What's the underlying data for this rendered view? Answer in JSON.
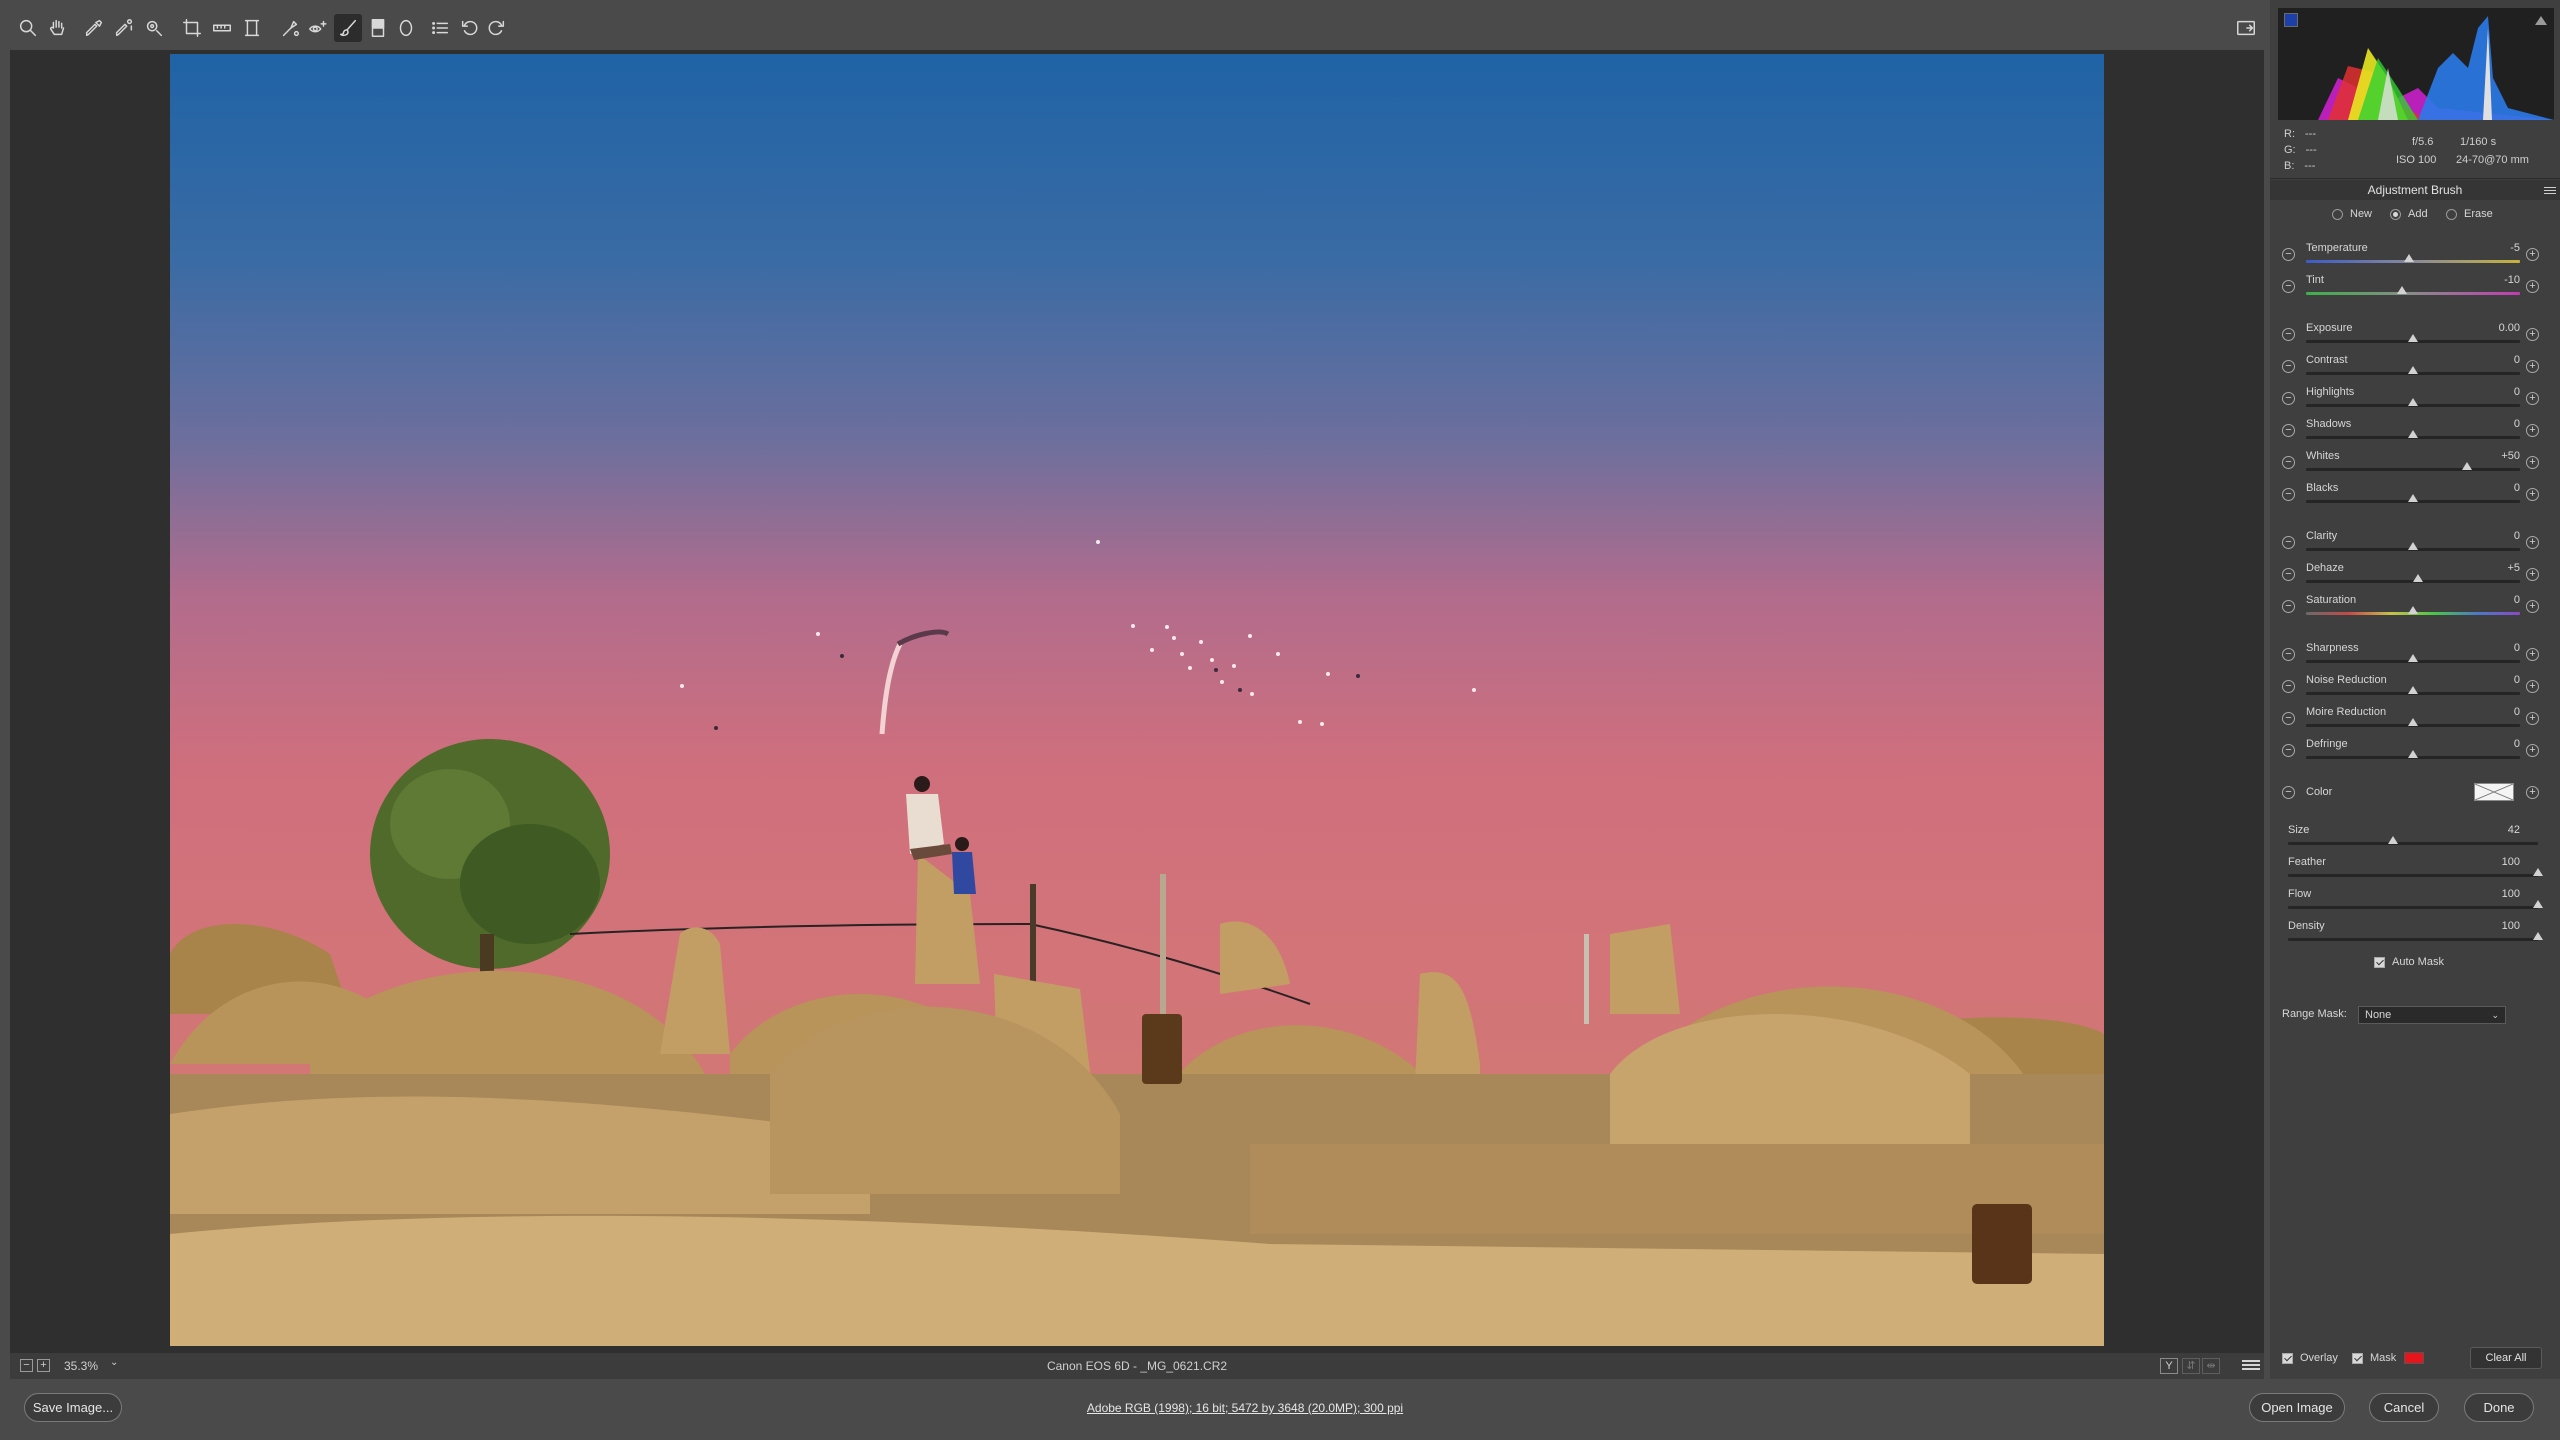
{
  "toolbar": {
    "tools": [
      {
        "name": "zoom-tool",
        "icon": "magnifier-icon"
      },
      {
        "name": "hand-tool",
        "icon": "hand-icon"
      },
      {
        "name": "white-balance-tool",
        "icon": "eyedropper-icon"
      },
      {
        "name": "color-sampler-tool",
        "icon": "color-sampler-icon"
      },
      {
        "name": "targeted-adjustment-tool",
        "icon": "target-icon"
      },
      {
        "name": "crop-tool",
        "icon": "crop-icon"
      },
      {
        "name": "straighten-tool",
        "icon": "straighten-icon"
      },
      {
        "name": "transform-tool",
        "icon": "transform-icon"
      },
      {
        "name": "spot-removal-tool",
        "icon": "spot-removal-icon"
      },
      {
        "name": "red-eye-tool",
        "icon": "red-eye-icon"
      },
      {
        "name": "adjustment-brush-tool",
        "icon": "brush-icon",
        "active": true
      },
      {
        "name": "graduated-filter-tool",
        "icon": "graduated-filter-icon"
      },
      {
        "name": "radial-filter-tool",
        "icon": "radial-filter-icon"
      },
      {
        "name": "preferences-tool",
        "icon": "list-icon"
      },
      {
        "name": "rotate-left-tool",
        "icon": "rotate-left-icon"
      },
      {
        "name": "rotate-right-tool",
        "icon": "rotate-right-icon"
      }
    ]
  },
  "status": {
    "zoom_out": "−",
    "zoom_in": "+",
    "zoom": "35.3%",
    "zoom_chevron": "⌄",
    "filename": "Canon EOS 6D  -  _MG_0621.CR2",
    "view_y": "Y",
    "view_2": "⇵",
    "view_3": "⇹"
  },
  "info": {
    "r_label": "R:",
    "r_value": "---",
    "g_label": "G:",
    "g_value": "---",
    "b_label": "B:",
    "b_value": "---",
    "aperture": "f/5.6",
    "shutter": "1/160 s",
    "iso": "ISO 100",
    "lens": "24-70@70 mm"
  },
  "panel": {
    "title": "Adjustment Brush",
    "modes": {
      "new": "New",
      "add": "Add",
      "erase": "Erase",
      "selected": "add"
    },
    "minus": "−",
    "plus": "+",
    "sliders": [
      {
        "label": "Temperature",
        "value": "-5",
        "pos": 0.48,
        "style": "temp"
      },
      {
        "label": "Tint",
        "value": "-10",
        "pos": 0.45,
        "style": "tint"
      },
      {
        "label": "Exposure",
        "value": "0.00",
        "pos": 0.5,
        "style": ""
      },
      {
        "label": "Contrast",
        "value": "0",
        "pos": 0.5,
        "style": ""
      },
      {
        "label": "Highlights",
        "value": "0",
        "pos": 0.5,
        "style": ""
      },
      {
        "label": "Shadows",
        "value": "0",
        "pos": 0.5,
        "style": ""
      },
      {
        "label": "Whites",
        "value": "+50",
        "pos": 0.75,
        "style": ""
      },
      {
        "label": "Blacks",
        "value": "0",
        "pos": 0.5,
        "style": ""
      },
      {
        "label": "Clarity",
        "value": "0",
        "pos": 0.5,
        "style": ""
      },
      {
        "label": "Dehaze",
        "value": "+5",
        "pos": 0.525,
        "style": ""
      },
      {
        "label": "Saturation",
        "value": "0",
        "pos": 0.5,
        "style": "sat"
      },
      {
        "label": "Sharpness",
        "value": "0",
        "pos": 0.5,
        "style": ""
      },
      {
        "label": "Noise Reduction",
        "value": "0",
        "pos": 0.5,
        "style": ""
      },
      {
        "label": "Moire Reduction",
        "value": "0",
        "pos": 0.5,
        "style": ""
      },
      {
        "label": "Defringe",
        "value": "0",
        "pos": 0.5,
        "style": ""
      }
    ],
    "color_label": "Color",
    "brush": [
      {
        "label": "Size",
        "value": "42",
        "pos": 0.42
      },
      {
        "label": "Feather",
        "value": "100",
        "pos": 1.0
      },
      {
        "label": "Flow",
        "value": "100",
        "pos": 1.0
      },
      {
        "label": "Density",
        "value": "100",
        "pos": 1.0
      }
    ],
    "auto_mask": "Auto Mask",
    "range_mask_label": "Range Mask:",
    "range_mask_value": "None",
    "range_chevron": "⌄",
    "overlay": "Overlay",
    "mask": "Mask",
    "mask_color": "#e8141c",
    "clear_all": "Clear All"
  },
  "bottom": {
    "save_image": "Save Image...",
    "workflow": "Adobe RGB (1998); 16 bit; 5472 by 3648 (20.0MP); 300 ppi",
    "open_image": "Open Image",
    "cancel": "Cancel",
    "done": "Done"
  }
}
